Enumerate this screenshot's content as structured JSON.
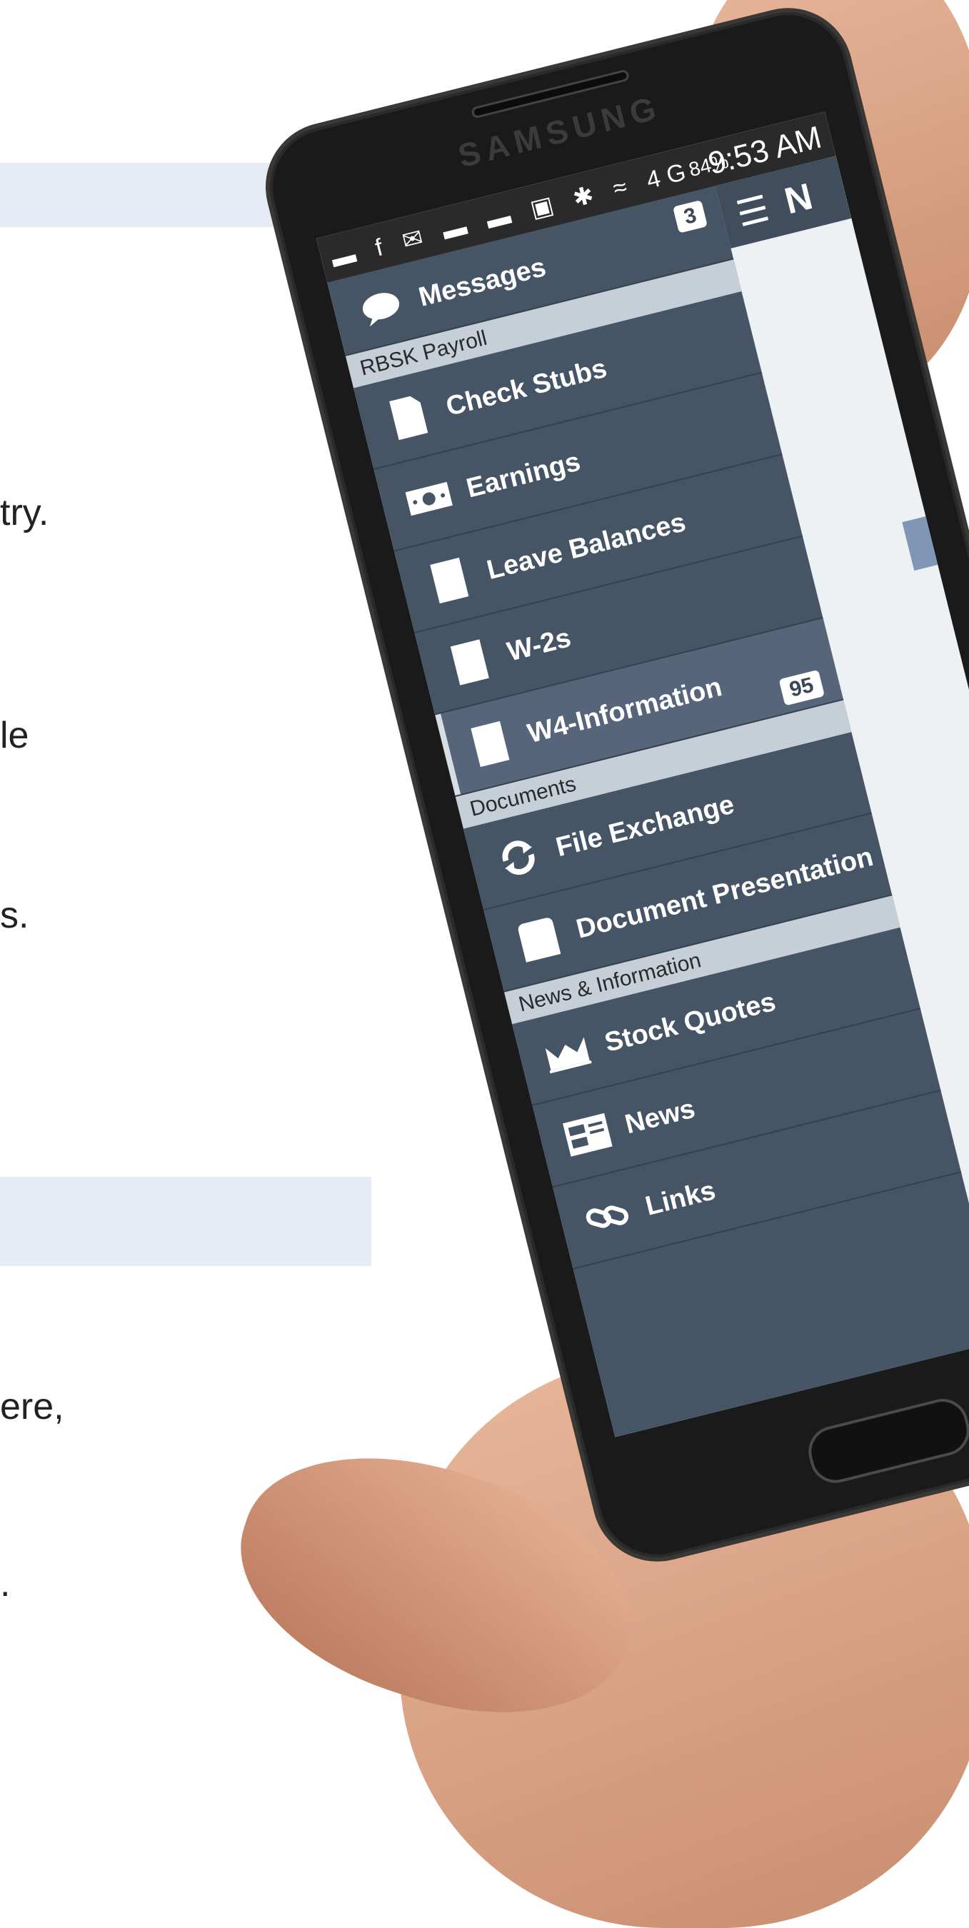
{
  "background_text": {
    "line1": "try.",
    "line2": "le",
    "line3": "s.",
    "line4": "ere,",
    "line5": "."
  },
  "phone": {
    "brand": "SAMSUNG"
  },
  "status_bar": {
    "notification_icons": "▬ f ✉ ▬ ▬ ▣ ✱ ≈ 4G",
    "battery": "84%",
    "time": "9:53 AM"
  },
  "app_bar": {
    "menu_icon": "menu-icon",
    "title_partial": "N"
  },
  "drawer": {
    "messages": {
      "label": "Messages",
      "badge": "3",
      "icon": "chat-bubble-icon"
    },
    "sections": [
      {
        "title": "RBSK Payroll",
        "items": [
          {
            "label": "Check Stubs",
            "icon": "document-icon"
          },
          {
            "label": "Earnings",
            "icon": "money-icon"
          },
          {
            "label": "Leave Balances",
            "icon": "document-icon"
          },
          {
            "label": "W-2s",
            "icon": "document-icon"
          },
          {
            "label": "W4-Information",
            "icon": "document-icon",
            "selected": true
          }
        ]
      },
      {
        "title": "Documents",
        "badge": "95",
        "items": [
          {
            "label": "File Exchange",
            "icon": "refresh-icon"
          },
          {
            "label": "Document Presentation",
            "icon": "folder-icon"
          }
        ]
      },
      {
        "title": "News & Information",
        "items": [
          {
            "label": "Stock Quotes",
            "icon": "chart-icon"
          },
          {
            "label": "News",
            "icon": "newspaper-icon"
          },
          {
            "label": "Links",
            "icon": "link-icon"
          }
        ]
      }
    ]
  },
  "colors": {
    "drawer_bg": "#465565",
    "section_bg": "#c6cfd7",
    "badge_bg": "#ffffff"
  }
}
